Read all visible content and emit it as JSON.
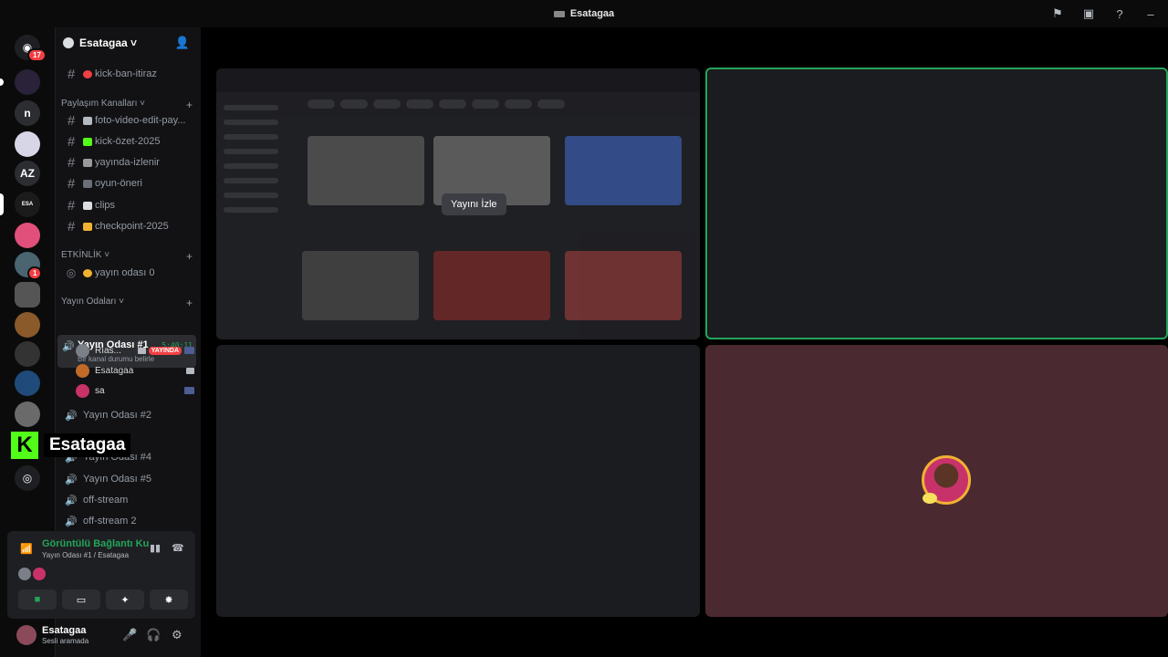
{
  "window": {
    "title": "Esatagaa"
  },
  "rail": {
    "home_badge": "17",
    "letters": [
      "n",
      "AZ"
    ],
    "server_badge": "1"
  },
  "guild": {
    "name": "Esatagaa"
  },
  "channels": {
    "top": [
      {
        "label": "kick-ban-itiraz"
      }
    ],
    "category_share": "Paylaşım Kanalları",
    "share": [
      {
        "label": "foto-video-edit-pay..."
      },
      {
        "label": "kick-özet-2025"
      },
      {
        "label": "yayında-izlenir"
      },
      {
        "label": "oyun-öneri"
      },
      {
        "label": "clips"
      },
      {
        "label": "checkpoint-2025"
      }
    ],
    "category_event": "ETKİNLİK",
    "event": [
      {
        "label": "yayın odası 0"
      }
    ],
    "category_voice": "Yayın Odaları",
    "active_voice": {
      "name": "Yayın Odası #1",
      "time": "5:40:11",
      "status": "Bir kanal durumu belirle"
    },
    "members": [
      {
        "name": "Rıas...",
        "live": "YAYINDA"
      },
      {
        "name": "Esatagaa"
      },
      {
        "name": "sa"
      }
    ],
    "voice": [
      {
        "label": "Yayın Odası #2"
      },
      {
        "label": "Yayın Odası #4"
      },
      {
        "label": "Yayın Odası #5"
      },
      {
        "label": "off-stream"
      },
      {
        "label": "off-stream 2"
      }
    ]
  },
  "overlay": {
    "label": "Esatagaa"
  },
  "voice_panel": {
    "status": "Görüntülü Bağlantı Ku",
    "channel": "Yayın Odası #1 / Esatagaa"
  },
  "user_panel": {
    "name": "Esatagaa",
    "status": "Sesli aramada"
  },
  "stage": {
    "watch_label": "Yayını İzle"
  },
  "colors": {
    "accent_green": "#23a55a",
    "live_red": "#f23f43",
    "kick_green": "#53fc18"
  }
}
